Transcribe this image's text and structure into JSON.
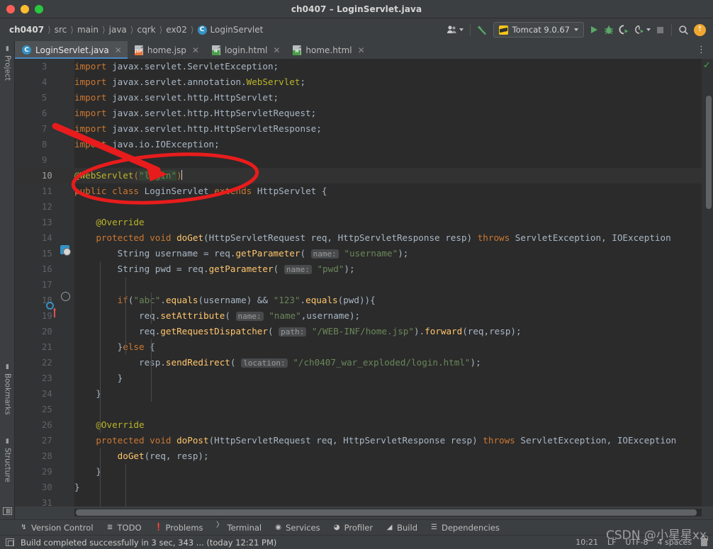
{
  "window": {
    "title": "ch0407 – LoginServlet.java",
    "traffic_lights": [
      "close",
      "minimize",
      "zoom"
    ]
  },
  "navbar": {
    "breadcrumb": [
      "ch0407",
      "src",
      "main",
      "java",
      "cqrk",
      "ex02",
      "LoginServlet"
    ],
    "class_icon_letter": "C",
    "toolbar": {
      "profile_icon": "user-profile-icon",
      "build_icon": "hammer-build-icon",
      "run_config": {
        "name": "Tomcat 9.0.67",
        "icon": "tomcat-icon"
      },
      "run_icon": "run-icon",
      "debug_icon": "debug-bug-icon",
      "coverage_icon": "run-with-coverage-icon",
      "profiler_icon": "profiler-icon",
      "stop_icon": "stop-icon",
      "search_icon": "search-icon",
      "update_icon": "update-arrow-icon"
    }
  },
  "left_strip": {
    "project": "Project",
    "bookmarks": "Bookmarks",
    "structure": "Structure"
  },
  "tabs": [
    {
      "label": "LoginServlet.java",
      "icon": "java-class-icon",
      "active": true
    },
    {
      "label": "home.jsp",
      "icon": "jsp-file-icon",
      "active": false
    },
    {
      "label": "login.html",
      "icon": "html-file-icon",
      "active": false
    },
    {
      "label": "home.html",
      "icon": "html-file-icon",
      "active": false
    }
  ],
  "editor": {
    "first_line": 3,
    "current_line": 10,
    "inspection_status": "ok-check-icon",
    "lines": [
      {
        "n": 3,
        "html": "<span class=\"kw\">import</span> javax.servlet.ServletException<span class=\"pun\">;</span>"
      },
      {
        "n": 4,
        "html": "<span class=\"kw\">import</span> javax.servlet.annotation.<span class=\"ann\">WebServlet</span><span class=\"pun\">;</span>"
      },
      {
        "n": 5,
        "html": "<span class=\"kw\">import</span> javax.servlet.http.HttpServlet<span class=\"pun\">;</span>"
      },
      {
        "n": 6,
        "html": "<span class=\"kw\">import</span> javax.servlet.http.HttpServletRequest<span class=\"pun\">;</span>"
      },
      {
        "n": 7,
        "html": "<span class=\"kw\">import</span> javax.servlet.http.HttpServletResponse<span class=\"pun\">;</span>"
      },
      {
        "n": 8,
        "html": "<span class=\"kw\">import</span> java.io.IOException<span class=\"pun\">;</span>"
      },
      {
        "n": 9,
        "html": ""
      },
      {
        "n": 10,
        "html": "<span class=\"ann\">@WebServlet</span><span class=\"kw\">(</span><span class=\"sel\"><span class=\"str\">\"login\"</span></span><span class=\"kw\">)</span><span class=\"caret-bar\"></span>",
        "highlight": true
      },
      {
        "n": 11,
        "html": "<span class=\"kw\">public class</span> <span class=\"cls\">LoginServlet</span> <span class=\"kw\">extends</span> HttpServlet <span class=\"pun\">{</span>"
      },
      {
        "n": 12,
        "html": ""
      },
      {
        "n": 13,
        "html": "    <span class=\"ann\">@Override</span>"
      },
      {
        "n": 14,
        "html": "    <span class=\"kw\">protected void</span> <span class=\"mth\">doGet</span>(HttpServletRequest req, HttpServletResponse resp) <span class=\"kw\">throws</span> ServletException, IOException"
      },
      {
        "n": 15,
        "html": "        String username = req.<span class=\"mth\">getParameter</span>( <span class=\"hint\">name:</span> <span class=\"str\">\"username\"</span>)<span class=\"pun\">;</span>"
      },
      {
        "n": 16,
        "html": "        String pwd = req.<span class=\"mth\">getParameter</span>( <span class=\"hint\">name:</span> <span class=\"str\">\"pwd\"</span>)<span class=\"pun\">;</span>"
      },
      {
        "n": 17,
        "html": ""
      },
      {
        "n": 18,
        "html": "        <span class=\"kw\">if</span>(<span class=\"str\">\"abc\"</span>.<span class=\"mth\">equals</span>(username) &amp;&amp; <span class=\"str\">\"123\"</span>.<span class=\"mth\">equals</span>(pwd)){"
      },
      {
        "n": 19,
        "html": "            req.<span class=\"mth\">setAttribute</span>( <span class=\"hint\">name:</span> <span class=\"str\">\"name\"</span>,username)<span class=\"pun\">;</span>"
      },
      {
        "n": 20,
        "html": "            req.<span class=\"mth\">getRequestDispatcher</span>( <span class=\"hint\">path:</span> <span class=\"str\">\"/WEB-INF/home.jsp\"</span>).<span class=\"mth\">forward</span>(req,resp)<span class=\"pun\">;</span>"
      },
      {
        "n": 21,
        "html": "        }<span class=\"kw\">else</span> {"
      },
      {
        "n": 22,
        "html": "            resp.<span class=\"mth\">sendRedirect</span>( <span class=\"hint\">location:</span> <span class=\"str\">\"/ch0407_war_exploded/login.html\"</span>)<span class=\"pun\">;</span>"
      },
      {
        "n": 23,
        "html": "        }"
      },
      {
        "n": 24,
        "html": "    }"
      },
      {
        "n": 25,
        "html": ""
      },
      {
        "n": 26,
        "html": "    <span class=\"ann\">@Override</span>"
      },
      {
        "n": 27,
        "html": "    <span class=\"kw\">protected void</span> <span class=\"mth\">doPost</span>(HttpServletRequest req, HttpServletResponse resp) <span class=\"kw\">throws</span> ServletException, IOException"
      },
      {
        "n": 28,
        "html": "        <span class=\"mth\">doGet</span>(req, resp)<span class=\"pun\">;</span>"
      },
      {
        "n": 29,
        "html": "    }"
      },
      {
        "n": 30,
        "html": "}"
      },
      {
        "n": 31,
        "html": ""
      }
    ]
  },
  "tool_windows": [
    {
      "label": "Version Control",
      "icon": "branch-icon"
    },
    {
      "label": "TODO",
      "icon": "list-icon"
    },
    {
      "label": "Problems",
      "icon": "error-icon"
    },
    {
      "label": "Terminal",
      "icon": "terminal-icon"
    },
    {
      "label": "Services",
      "icon": "services-play-icon"
    },
    {
      "label": "Profiler",
      "icon": "profiler-gauge-icon"
    },
    {
      "label": "Build",
      "icon": "hammer-icon"
    },
    {
      "label": "Dependencies",
      "icon": "layers-icon"
    }
  ],
  "statusbar": {
    "message": "Build completed successfully in 3 sec, 343 ... (today 12:21 PM)",
    "caret_position": "10:21",
    "line_separator": "LF",
    "encoding": "UTF-8",
    "indent": "4 spaces",
    "lock_icon": "read-only-lock-icon"
  },
  "annotations": {
    "arrow": "red-arrow-pointing-to-webservlet-annotation",
    "ellipse": "red-ellipse-around-webservlet-login"
  },
  "watermark": "CSDN @小星星xx",
  "colors": {
    "accent_blue": "#3592c4",
    "keyword_orange": "#cc7832",
    "string_green": "#6a8759",
    "annotation_yellow": "#bbb529",
    "method_yellow": "#ffc66d",
    "editor_bg": "#2b2b2b",
    "chrome_bg": "#3c3f41",
    "annotation_red": "#e81c1c"
  }
}
